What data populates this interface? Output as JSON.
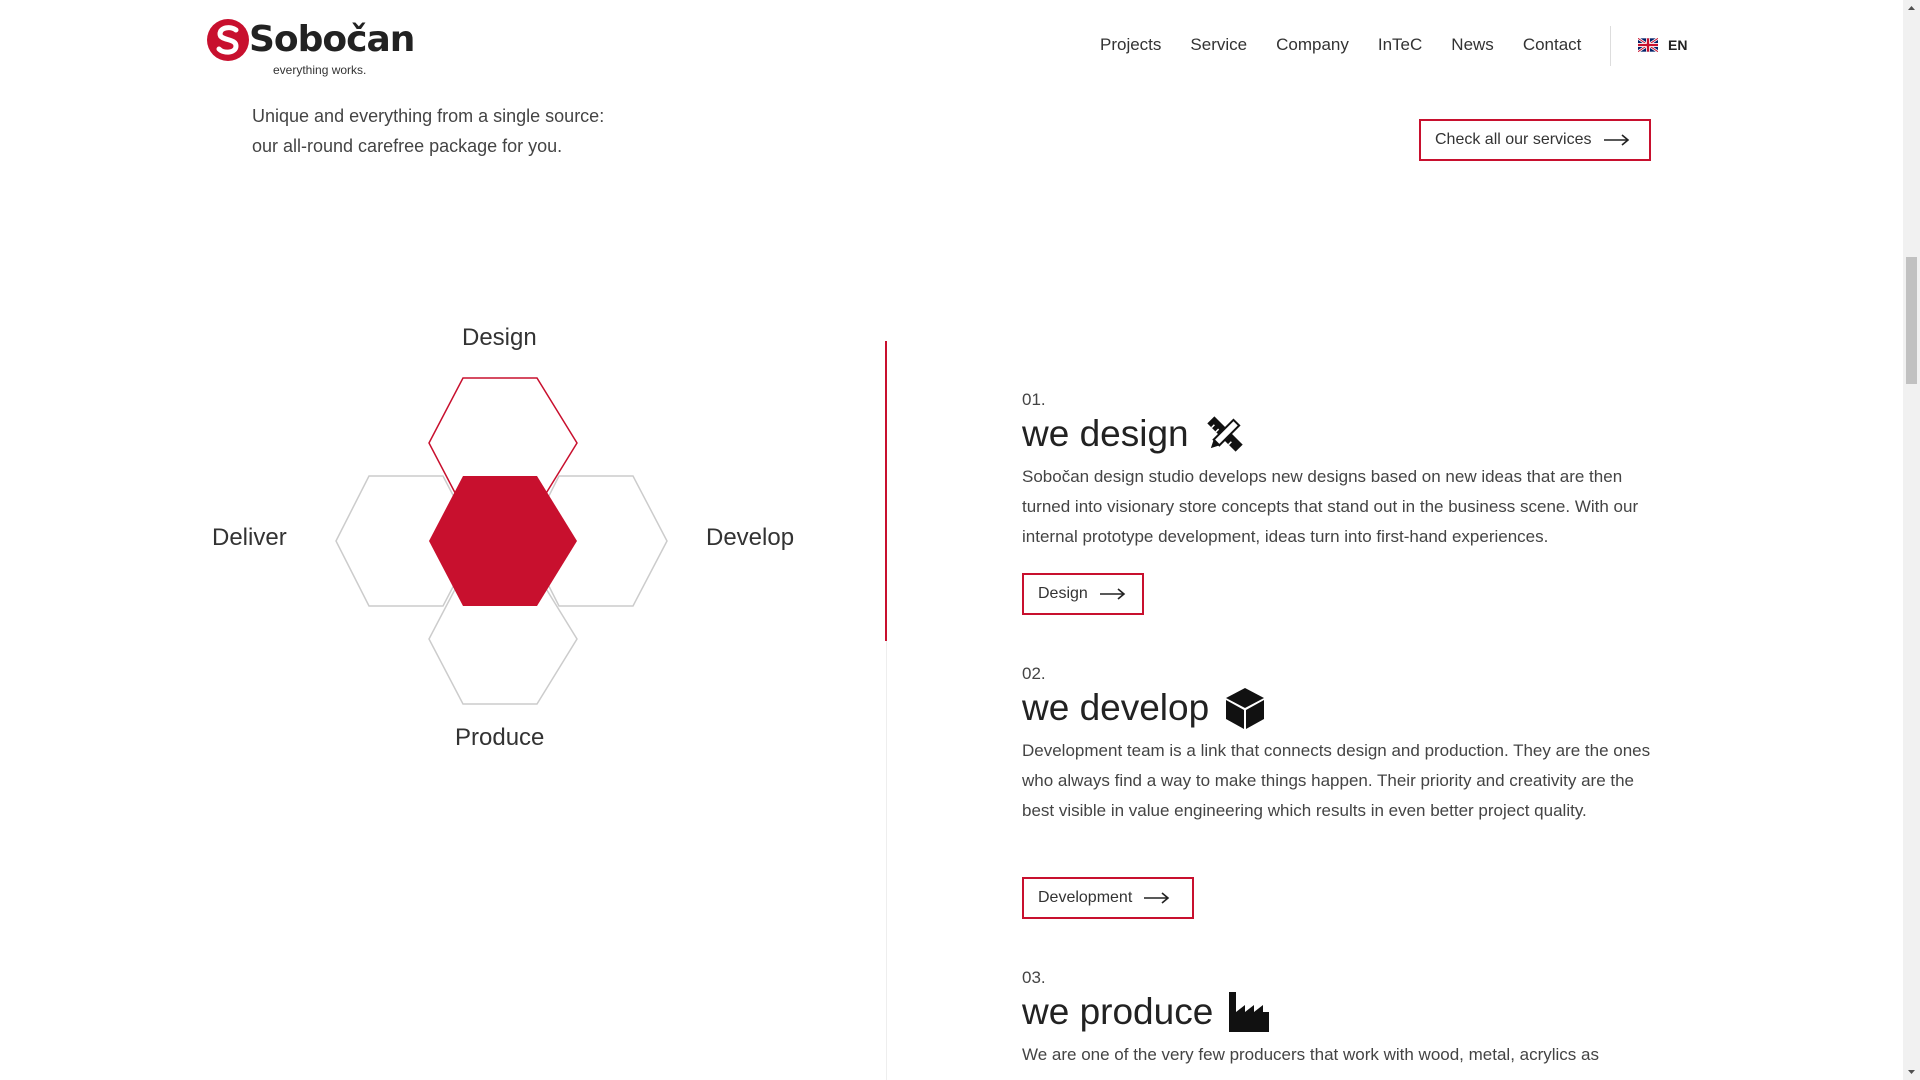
{
  "header": {
    "logo_word": "Sobočan",
    "logo_tagline": "everything works.",
    "nav": [
      "Projects",
      "Service",
      "Company",
      "InTeC",
      "News",
      "Contact"
    ],
    "language": "EN"
  },
  "intro": {
    "line1": "Unique and everything from a single source:",
    "line2": "our all-round carefree package for you.",
    "button_label": "Check all our services"
  },
  "diagram": {
    "labels": {
      "top": "Design",
      "left": "Deliver",
      "right": "Develop",
      "bottom": "Produce"
    },
    "colors": {
      "accent": "#c8102e",
      "outline": "#cccccc"
    }
  },
  "steps": [
    {
      "number": "01.",
      "title": "we design",
      "icon": "pencil-ruler-icon",
      "text": "Sobočan design studio develops new designs based on new ideas that are then turned into visionary store concepts that stand out in the business scene. With our internal prototype development, ideas turn into first-hand experiences.",
      "button_label": "Design"
    },
    {
      "number": "02.",
      "title": "we develop",
      "icon": "cube-icon",
      "text": "Development team is a link that connects design and production. They are the ones who always find a way to make things happen. Their priority and creativity are the best visible in value engineering which results in even better project quality.",
      "button_label": "Development"
    },
    {
      "number": "03.",
      "title": "we produce",
      "icon": "factory-icon",
      "text": "We are one of the very few producers that work with wood, metal, acrylics as"
    }
  ],
  "colors": {
    "brand": "#c8102e",
    "text": "#333333"
  }
}
